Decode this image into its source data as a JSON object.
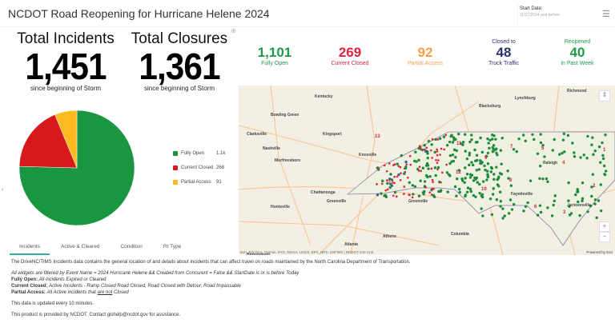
{
  "header": {
    "title": "NCDOT Road Reopening for Hurricane Helene 2024",
    "date_label": "Start Date:",
    "date_value": "11/27/2024 and before"
  },
  "totals": [
    {
      "label": "Total Incidents",
      "value": "1,451",
      "sub": "since beginning of Storm"
    },
    {
      "label": "Total Closures",
      "value": "1,361",
      "sub": "since beginning of Storm"
    }
  ],
  "chart_data": {
    "type": "pie",
    "title": "",
    "slices": [
      {
        "label": "Fully Open",
        "value": 1101,
        "display": "1.1k",
        "color": "#1a9641"
      },
      {
        "label": "Current Closed",
        "value": 268,
        "display": "268",
        "color": "#d7191c"
      },
      {
        "label": "Partial Access",
        "value": 91,
        "display": "91",
        "color": "#fdba20"
      }
    ],
    "legend": "right"
  },
  "tabs": [
    "Incidents",
    "Active & Cleared",
    "Condition",
    "Rt Type"
  ],
  "stats": [
    {
      "value": "1,101",
      "label": "Fully Open",
      "color": "#1e9a49"
    },
    {
      "value": "269",
      "label": "Current Closed",
      "color": "#e0203c"
    },
    {
      "value": "92",
      "label": "Partial Access",
      "color": "#f5a04a"
    },
    {
      "top": "Closed to",
      "value": "48",
      "label": "Truck Traffic",
      "color": "#2d2d6e"
    },
    {
      "top": "Reopened",
      "value": "40",
      "label": "in Past Week",
      "color": "#1e9a49"
    }
  ],
  "map": {
    "cities": [
      "Richmond",
      "Lynchburg",
      "Kentucky",
      "Bowling Green",
      "Blacksburg",
      "Clarksville",
      "Kingsport",
      "Nashville",
      "Knoxville",
      "Murfreesboro",
      "Chattanooga",
      "Huntsville",
      "Greenville",
      "Athens",
      "Columbia",
      "Atlanta",
      "Birmingham",
      "Raleigh",
      "Fayetteville",
      "Jacksonville",
      "Greenville"
    ],
    "divisions": [
      "1",
      "2",
      "3",
      "4",
      "5",
      "6",
      "7",
      "8",
      "9",
      "10",
      "11",
      "12",
      "13",
      "14"
    ],
    "attribution": "Esri, TomTom, Garmin, FAO, NOAA, USGS, EPA, NPS, USFWS | NCDOT GIS Unit",
    "powered": "Powered by Esri",
    "zoom_in": "+",
    "zoom_out": "−"
  },
  "info": {
    "p1": "The DriveNC/TIMS Incidents data contains the general location of and details about incidents that can affect travel on roads maintained by the North Carolina Department of Transportation.",
    "filter": "All widgets are filtered by Event Name = 2024 Hurricane Helene && Created from Concurent = False && StartDate is or is before Today",
    "fo_label": "Fully Open:",
    "fo_text": "All incidents Expired or Cleared",
    "cc_label": "Current Closed:",
    "cc_text": "Active Incidents - Ramp Closed Road Closed, Road Closed with Detour, Road Impassable",
    "pa_label": "Partial Access:",
    "pa_text1": "All Active incidents that",
    "pa_not": "are not",
    "pa_text2": "Closed",
    "update": "This data is updated every 10 minutes.",
    "contact": "This product is provided by NCDOT.   Contact gishelp@ncdot.gov for assistance."
  }
}
